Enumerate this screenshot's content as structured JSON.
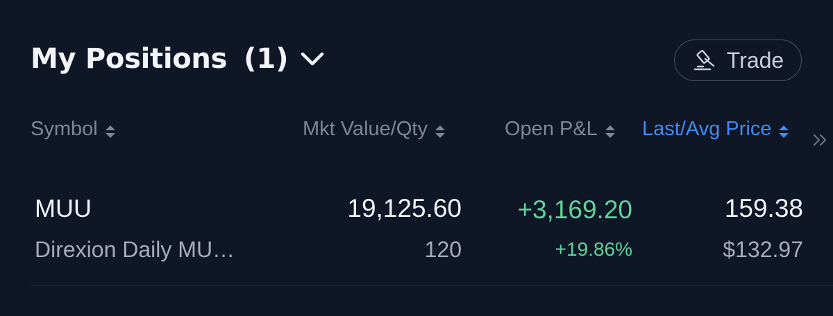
{
  "header": {
    "title": "My Positions",
    "count": "(1)",
    "trade_label": "Trade"
  },
  "columns": {
    "symbol": "Symbol",
    "mkt_value_qty": "Mkt Value/Qty",
    "open_pnl": "Open P&L",
    "last_avg_price": "Last/Avg Price"
  },
  "icons": {
    "title_toggle": "chevron-down-icon",
    "trade": "gavel-icon",
    "sort": "sort-updown-icon",
    "more": "double-chevron-right-icon"
  },
  "colors": {
    "background": "#0f1626",
    "active_column": "#3f8cf2",
    "gain": "#5fd39a",
    "muted_text": "#7f8797"
  },
  "positions": [
    {
      "symbol": "MUU",
      "name": "Direxion Daily MU…",
      "market_value": "19,125.60",
      "quantity": "120",
      "open_pnl": "+3,169.20",
      "open_pnl_pct": "+19.86%",
      "last_price": "159.38",
      "avg_price": "$132.97"
    }
  ]
}
